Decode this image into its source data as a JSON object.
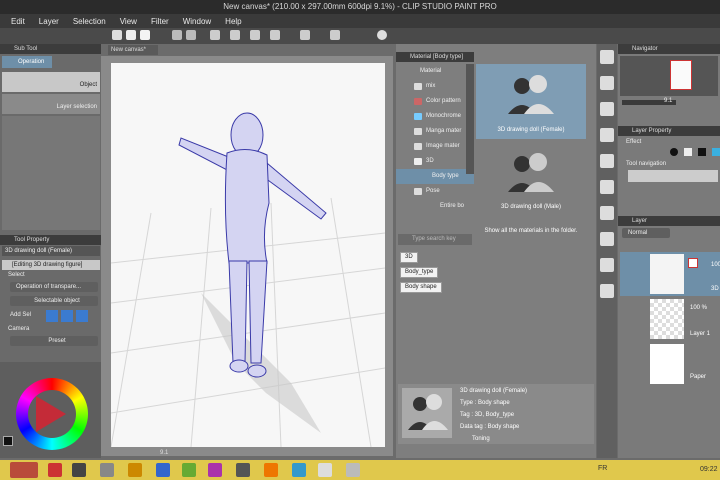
{
  "window": {
    "title": "New canvas* (210.00 x 297.00mm 600dpi 9.1%) - CLIP STUDIO PAINT PRO"
  },
  "menu": [
    "Edit",
    "Layer",
    "Selection",
    "View",
    "Filter",
    "Window",
    "Help"
  ],
  "canvas": {
    "tab": "New canvas*",
    "zoom": "9.1"
  },
  "subtool": {
    "header": "Sub Tool",
    "tab": "Operation",
    "items": [
      "Object",
      "Layer selection"
    ]
  },
  "toolprop": {
    "header": "Tool Property",
    "subheader": "3D drawing doll (Female)",
    "editing": "[Editing 3D drawing figure]",
    "select_label": "Select",
    "operation_value": "Operation of transpare...",
    "selectable_value": "Selectable object",
    "add_label": "Add Sel",
    "camera_label": "Camera",
    "preset_value": "Preset"
  },
  "material": {
    "header": "Material [Body type]",
    "tree": [
      "Material",
      "mix",
      "Color pattern",
      "Monochrome",
      "Manga mater",
      "Image mater",
      "3D",
      "Body type",
      "Pose",
      "Entire bo"
    ],
    "items": [
      "3D drawing doll (Female)",
      "3D drawing doll (Male)"
    ],
    "show_all": "Show all the materials in the folder.",
    "search_placeholder": "Type search key",
    "tags": [
      "3D",
      "Body_type",
      "Body shape"
    ],
    "detail": {
      "name": "3D drawing doll (Female)",
      "type": "Type : Body shape",
      "tag": "Tag : 3D, Body_type",
      "datatag": "Data tag : Body shape",
      "extra": "Toning"
    }
  },
  "navigator": {
    "header": "Navigator",
    "zoom": "9.1"
  },
  "layerprop": {
    "header": "Layer Property",
    "effect": "Effect",
    "tool_nav": "Tool navigation"
  },
  "layers": {
    "header": "Layer",
    "blend": "Normal",
    "rows": [
      {
        "opacity": "100",
        "name": "3D"
      },
      {
        "opacity": "100 %",
        "name": "Layer 1"
      },
      {
        "opacity": "",
        "name": "Paper"
      }
    ]
  },
  "taskbar": {
    "lang": "FR",
    "time": "09:22"
  },
  "colors": {
    "accent": "#6e8fa8",
    "taskbar": "#e0c84c",
    "doll": "#c8c8f0",
    "wire": "#3a3aa8"
  }
}
